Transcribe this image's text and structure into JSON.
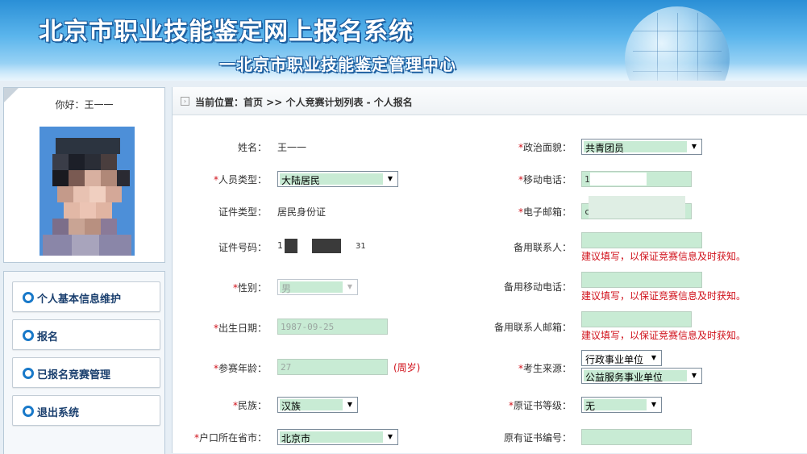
{
  "header": {
    "title": "北京市职业技能鉴定网上报名系统",
    "subtitle": "一北京市职业技能鉴定管理中心"
  },
  "sidebar": {
    "greeting": "你好：王一一",
    "menu": [
      {
        "label": "个人基本信息维护"
      },
      {
        "label": "报名"
      },
      {
        "label": "已报名竞赛管理"
      },
      {
        "label": "退出系统"
      }
    ]
  },
  "breadcrumb": "当前位置：首页 >> 个人竞赛计划列表 - 个人报名",
  "form": {
    "left": [
      {
        "label": "姓名：",
        "required": false,
        "value": "王一一"
      },
      {
        "label": "人员类型：",
        "required": true,
        "value": "大陆居民"
      },
      {
        "label": "证件类型：",
        "required": false,
        "value": "居民身份证"
      },
      {
        "label": "证件号码：",
        "required": false,
        "value_prefix": "1",
        "value_suffix": "31"
      },
      {
        "label": "性别：",
        "required": true,
        "value": "男"
      },
      {
        "label": "出生日期：",
        "required": true,
        "value": "1987-09-25"
      },
      {
        "label": "参赛年龄：",
        "required": true,
        "value": "27",
        "unit": "(周岁)"
      },
      {
        "label": "民族：",
        "required": true,
        "value": "汉族"
      },
      {
        "label": "户口所在省市：",
        "required": true,
        "value": "北京市"
      }
    ],
    "right": [
      {
        "label": "政治面貌：",
        "required": true,
        "value": "共青团员"
      },
      {
        "label": "移动电话：",
        "required": true,
        "value": "1"
      },
      {
        "label": "电子邮箱：",
        "required": true,
        "value": "c"
      },
      {
        "label": "备用联系人：",
        "required": false,
        "hint": "建议填写，以保证竞赛信息及时获知。"
      },
      {
        "label": "备用移动电话：",
        "required": false,
        "hint": "建议填写，以保证竞赛信息及时获知。"
      },
      {
        "label": "备用联系人邮箱：",
        "required": false,
        "hint": "建议填写，以保证竞赛信息及时获知。"
      },
      {
        "label": "考生来源：",
        "required": true,
        "value": "行政事业单位",
        "value2": "公益服务事业单位"
      },
      {
        "label": "原证书等级：",
        "required": true,
        "value": "无"
      },
      {
        "label": "原有证书编号：",
        "required": false,
        "value": ""
      }
    ]
  },
  "colors": {
    "required_star": "#d0101a",
    "field_fill": "#c8ebd4",
    "menu_dot": "#1979c9",
    "menu_text": "#1a3f6e"
  }
}
